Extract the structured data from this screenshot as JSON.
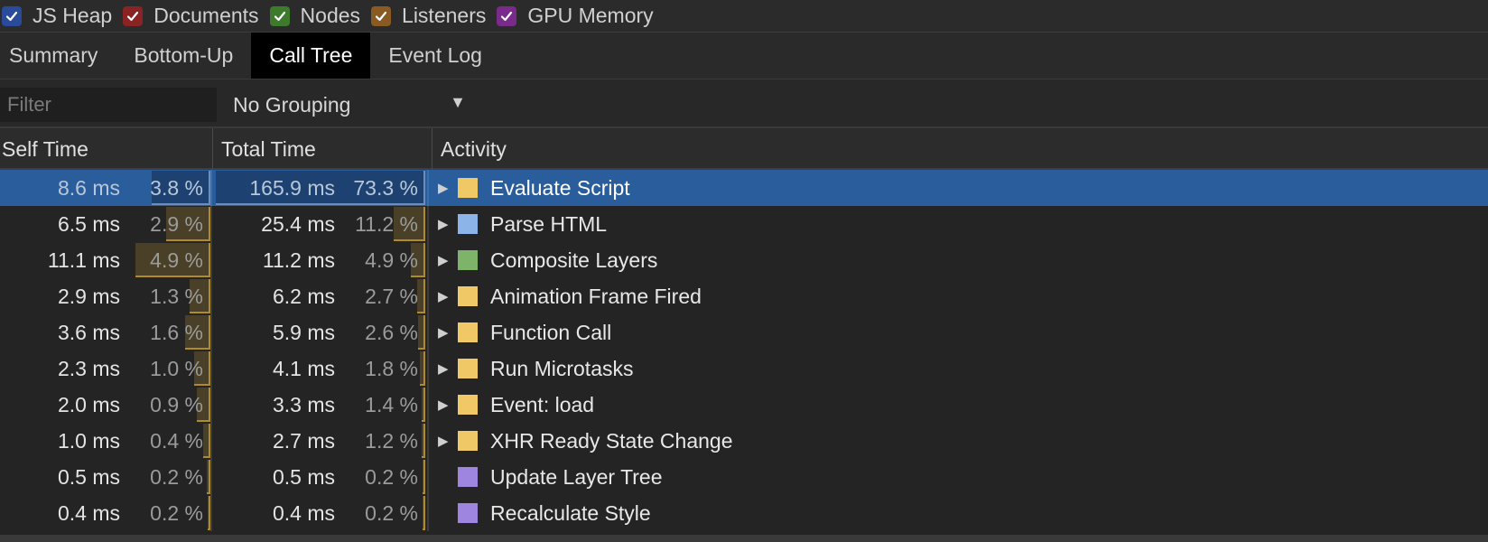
{
  "counters": [
    {
      "label": "JS Heap",
      "color": "#2a4a9a",
      "checked": true
    },
    {
      "label": "Documents",
      "color": "#8a2323",
      "checked": true
    },
    {
      "label": "Nodes",
      "color": "#3d7a2b",
      "checked": true
    },
    {
      "label": "Listeners",
      "color": "#8a5a23",
      "checked": true
    },
    {
      "label": "GPU Memory",
      "color": "#7a2a8a",
      "checked": true
    }
  ],
  "tabs": [
    {
      "label": "Summary",
      "active": false
    },
    {
      "label": "Bottom-Up",
      "active": false
    },
    {
      "label": "Call Tree",
      "active": true
    },
    {
      "label": "Event Log",
      "active": false
    }
  ],
  "toolbar": {
    "filter_placeholder": "Filter",
    "filter_value": "",
    "grouping": "No Grouping",
    "caret": "▼"
  },
  "columns": {
    "self": "Self Time",
    "total": "Total Time",
    "activity": "Activity"
  },
  "rows": [
    {
      "self_ms": "8.6 ms",
      "self_pct": "3.8 %",
      "total_ms": "165.9 ms",
      "total_pct": "73.3 %",
      "activity": "Evaluate Script",
      "color": "#f0c866",
      "expandable": true,
      "selected": true,
      "self_frac": 0.052,
      "total_frac": 0.733
    },
    {
      "self_ms": "6.5 ms",
      "self_pct": "2.9 %",
      "total_ms": "25.4 ms",
      "total_pct": "11.2 %",
      "activity": "Parse HTML",
      "color": "#8db4e8",
      "expandable": true,
      "selected": false,
      "self_frac": 0.039,
      "total_frac": 0.112
    },
    {
      "self_ms": "11.1 ms",
      "self_pct": "4.9 %",
      "total_ms": "11.2 ms",
      "total_pct": "4.9 %",
      "activity": "Composite Layers",
      "color": "#7eb36a",
      "expandable": true,
      "selected": false,
      "self_frac": 0.066,
      "total_frac": 0.049
    },
    {
      "self_ms": "2.9 ms",
      "self_pct": "1.3 %",
      "total_ms": "6.2 ms",
      "total_pct": "2.7 %",
      "activity": "Animation Frame Fired",
      "color": "#f0c866",
      "expandable": true,
      "selected": false,
      "self_frac": 0.018,
      "total_frac": 0.027
    },
    {
      "self_ms": "3.6 ms",
      "self_pct": "1.6 %",
      "total_ms": "5.9 ms",
      "total_pct": "2.6 %",
      "activity": "Function Call",
      "color": "#f0c866",
      "expandable": true,
      "selected": false,
      "self_frac": 0.022,
      "total_frac": 0.026
    },
    {
      "self_ms": "2.3 ms",
      "self_pct": "1.0 %",
      "total_ms": "4.1 ms",
      "total_pct": "1.8 %",
      "activity": "Run Microtasks",
      "color": "#f0c866",
      "expandable": true,
      "selected": false,
      "self_frac": 0.014,
      "total_frac": 0.018
    },
    {
      "self_ms": "2.0 ms",
      "self_pct": "0.9 %",
      "total_ms": "3.3 ms",
      "total_pct": "1.4 %",
      "activity": "Event: load",
      "color": "#f0c866",
      "expandable": true,
      "selected": false,
      "self_frac": 0.012,
      "total_frac": 0.014
    },
    {
      "self_ms": "1.0 ms",
      "self_pct": "0.4 %",
      "total_ms": "2.7 ms",
      "total_pct": "1.2 %",
      "activity": "XHR Ready State Change",
      "color": "#f0c866",
      "expandable": true,
      "selected": false,
      "self_frac": 0.006,
      "total_frac": 0.012
    },
    {
      "self_ms": "0.5 ms",
      "self_pct": "0.2 %",
      "total_ms": "0.5 ms",
      "total_pct": "0.2 %",
      "activity": "Update Layer Tree",
      "color": "#9e86e0",
      "expandable": false,
      "selected": false,
      "self_frac": 0.003,
      "total_frac": 0.002
    },
    {
      "self_ms": "0.4 ms",
      "self_pct": "0.2 %",
      "total_ms": "0.4 ms",
      "total_pct": "0.2 %",
      "activity": "Recalculate Style",
      "color": "#9e86e0",
      "expandable": false,
      "selected": false,
      "self_frac": 0.002,
      "total_frac": 0.002
    }
  ]
}
